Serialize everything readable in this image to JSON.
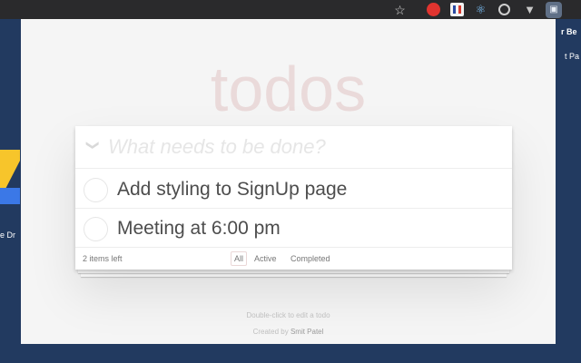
{
  "browser": {
    "extensions": [
      {
        "name": "star-icon",
        "glyph": "☆"
      },
      {
        "name": "extension-red-icon",
        "glyph": "●"
      },
      {
        "name": "extension-flag-icon",
        "glyph": ""
      },
      {
        "name": "react-devtools-icon",
        "glyph": "⚛"
      },
      {
        "name": "extension-target-icon",
        "glyph": ""
      },
      {
        "name": "vue-devtools-icon",
        "glyph": "▼"
      },
      {
        "name": "extension-profile-icon",
        "glyph": "▣"
      }
    ]
  },
  "desktop": {
    "left_label": "e Dr",
    "right_label_1": "r Be",
    "right_label_2": "t Pa"
  },
  "app": {
    "title": "todos",
    "new_todo": {
      "placeholder": "What needs to be done?",
      "value": "",
      "toggle_all_glyph": "❯"
    },
    "todos": [
      {
        "label": "Add styling to SignUp page",
        "completed": false
      },
      {
        "label": "Meeting at 6:00 pm",
        "completed": false
      }
    ],
    "footer": {
      "items_left": "2 items left",
      "filters": [
        "All",
        "Active",
        "Completed"
      ],
      "selected_filter": "All"
    },
    "info": {
      "hint": "Double-click to edit a todo",
      "credit_prefix": "Created by ",
      "credit_author": "Smit Patel"
    }
  },
  "colors": {
    "title": "#eadada",
    "background": "#f5f5f5",
    "desktop": "#223a60"
  }
}
